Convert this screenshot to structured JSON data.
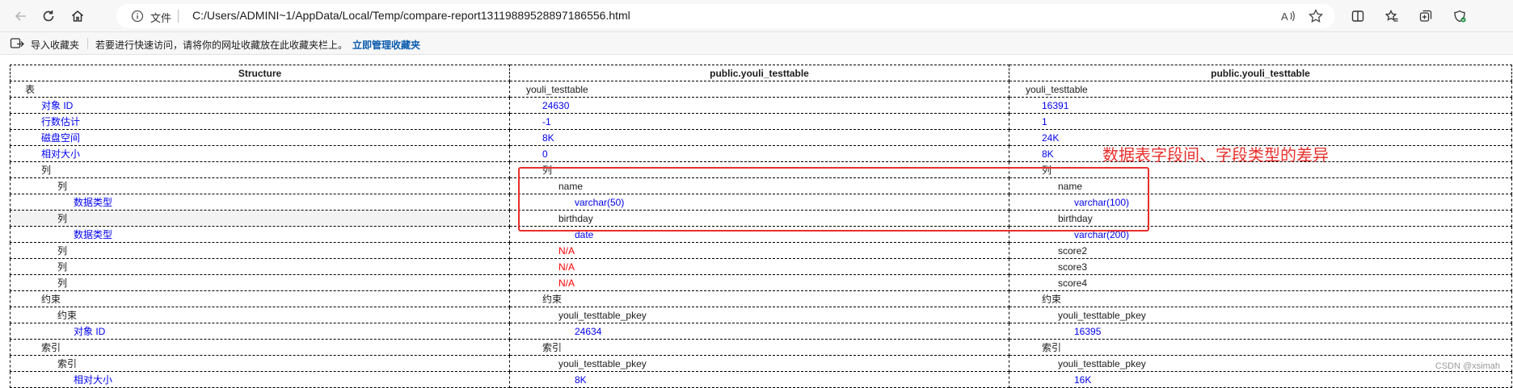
{
  "browser": {
    "url_scheme": "文件",
    "url": "C:/Users/ADMINI~1/AppData/Local/Temp/compare-report13119889528897186556.html",
    "icons": [
      "back-icon",
      "refresh-icon",
      "home-icon",
      "info-icon",
      "read-aloud-icon",
      "favorite-star-icon",
      "split-screen-icon",
      "favorites-icon",
      "collections-icon",
      "browser-essentials-icon"
    ]
  },
  "bookmarks_bar": {
    "import_label": "导入收藏夹",
    "hint": "若要进行快速访问，请将你的网址收藏放在此收藏夹栏上。",
    "manage_link": "立即管理收藏夹"
  },
  "report": {
    "headers": [
      "Structure",
      "public.youli_testtable",
      "public.youli_testtable"
    ],
    "rows": [
      {
        "label": "表",
        "left": "youli_testtable",
        "right": "youli_testtable"
      },
      {
        "label": "对象 ID",
        "left": "24630",
        "right": "16391"
      },
      {
        "label": "行数估计",
        "left": "-1",
        "right": "1"
      },
      {
        "label": "磁盘空间",
        "left": "8K",
        "right": "24K"
      },
      {
        "label": "相对大小",
        "left": "0",
        "right": "8K"
      },
      {
        "label": "列",
        "left": "列",
        "right": "列"
      },
      {
        "label": "列",
        "left": "name",
        "right": "name"
      },
      {
        "label": "数据类型",
        "left": "varchar(50)",
        "right": "varchar(100)"
      },
      {
        "label": "列",
        "left": "birthday",
        "right": "birthday"
      },
      {
        "label": "数据类型",
        "left": "date",
        "right": "varchar(200)"
      },
      {
        "label": "列",
        "left": "N/A",
        "right": "score2"
      },
      {
        "label": "列",
        "left": "N/A",
        "right": "score3"
      },
      {
        "label": "列",
        "left": "N/A",
        "right": "score4"
      },
      {
        "label": "约束",
        "left": "约束",
        "right": "约束"
      },
      {
        "label": "约束",
        "left": "youli_testtable_pkey",
        "right": "youli_testtable_pkey"
      },
      {
        "label": "对象 ID",
        "left": "24634",
        "right": "16395"
      },
      {
        "label": "索引",
        "left": "索引",
        "right": "索引"
      },
      {
        "label": "索引",
        "left": "youli_testtable_pkey",
        "right": "youli_testtable_pkey"
      },
      {
        "label": "相对大小",
        "left": "8K",
        "right": "16K"
      }
    ]
  },
  "annotation": {
    "text": "数据表字段间、字段类型的差异",
    "color": "#e8302c"
  },
  "watermark": "CSDN @xsimah",
  "colors": {
    "property_blue": "#0000ee",
    "missing_red": "#ff0000",
    "link_blue": "#0b5cad"
  }
}
